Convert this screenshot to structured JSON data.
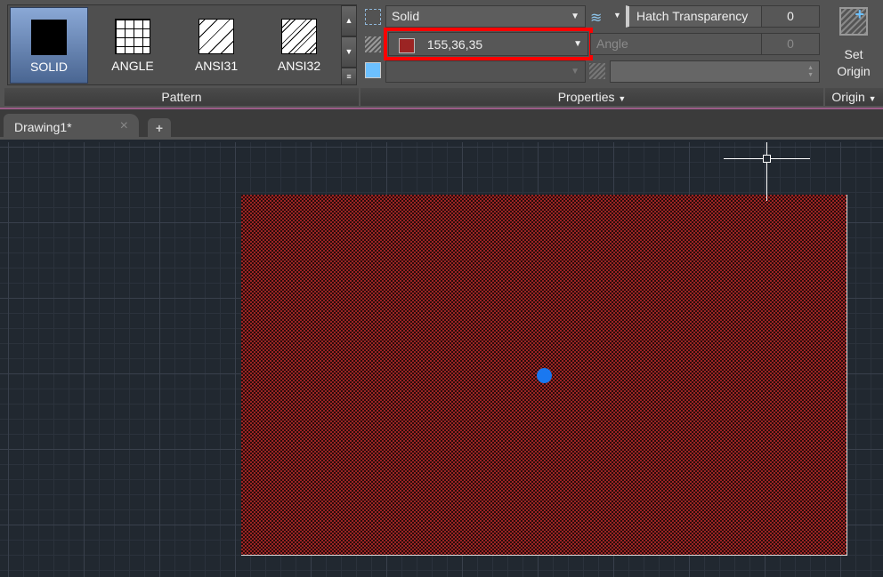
{
  "ribbon": {
    "pattern_panel": {
      "title": "Pattern",
      "items": [
        {
          "label": "SOLID",
          "selected": true
        },
        {
          "label": "ANGLE"
        },
        {
          "label": "ANSI31"
        },
        {
          "label": "ANSI32"
        }
      ]
    },
    "properties_panel": {
      "title": "Properties",
      "hatch_type": "Solid",
      "hatch_color": "155,36,35",
      "hatch_color_hex": "#9b2423",
      "background_color": "",
      "transparency_label": "Hatch Transparency",
      "transparency_value": "0",
      "angle_label": "Angle",
      "angle_value": "0",
      "scale_value": ""
    },
    "origin_panel": {
      "title": "Origin",
      "button_label_1": "Set",
      "button_label_2": "Origin"
    }
  },
  "tabs": {
    "items": [
      {
        "label": "Drawing1*",
        "active": true
      }
    ],
    "close_glyph": "×",
    "new_glyph": "+"
  },
  "accent": "#ff0000"
}
